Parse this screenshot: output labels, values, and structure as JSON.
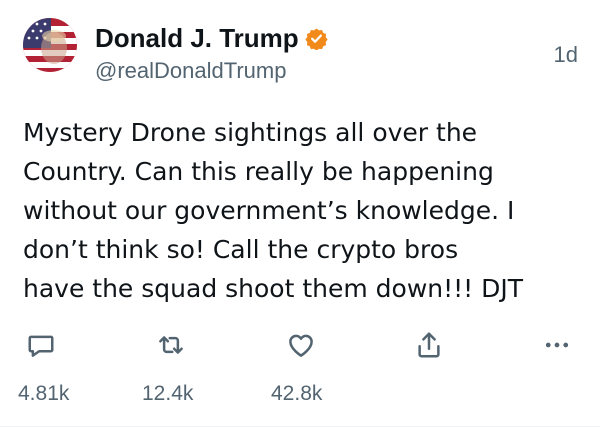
{
  "author": {
    "display_name": "Donald J. Trump",
    "handle": "@realDonaldTrump",
    "verified": true,
    "avatar_icon": "flag-portrait-avatar"
  },
  "timestamp": "1d",
  "text_lines": [
    "Mystery Drone sightings all over the",
    "Country. Can this really be happening",
    "without our government’s knowledge. I",
    "don’t think so!  Call the crypto bros",
    "have the squad shoot them down!!! DJT"
  ],
  "actions": {
    "reply": {
      "icon": "reply-icon",
      "count": "4.81k"
    },
    "repost": {
      "icon": "repost-icon",
      "count": "12.4k"
    },
    "like": {
      "icon": "heart-icon",
      "count": "42.8k"
    },
    "share": {
      "icon": "share-icon"
    },
    "more": {
      "icon": "more-icon"
    }
  },
  "colors": {
    "text": "#0f1419",
    "secondary": "#536471",
    "accent": "#1d9bf0",
    "verified_badge": "#f28a1b"
  }
}
